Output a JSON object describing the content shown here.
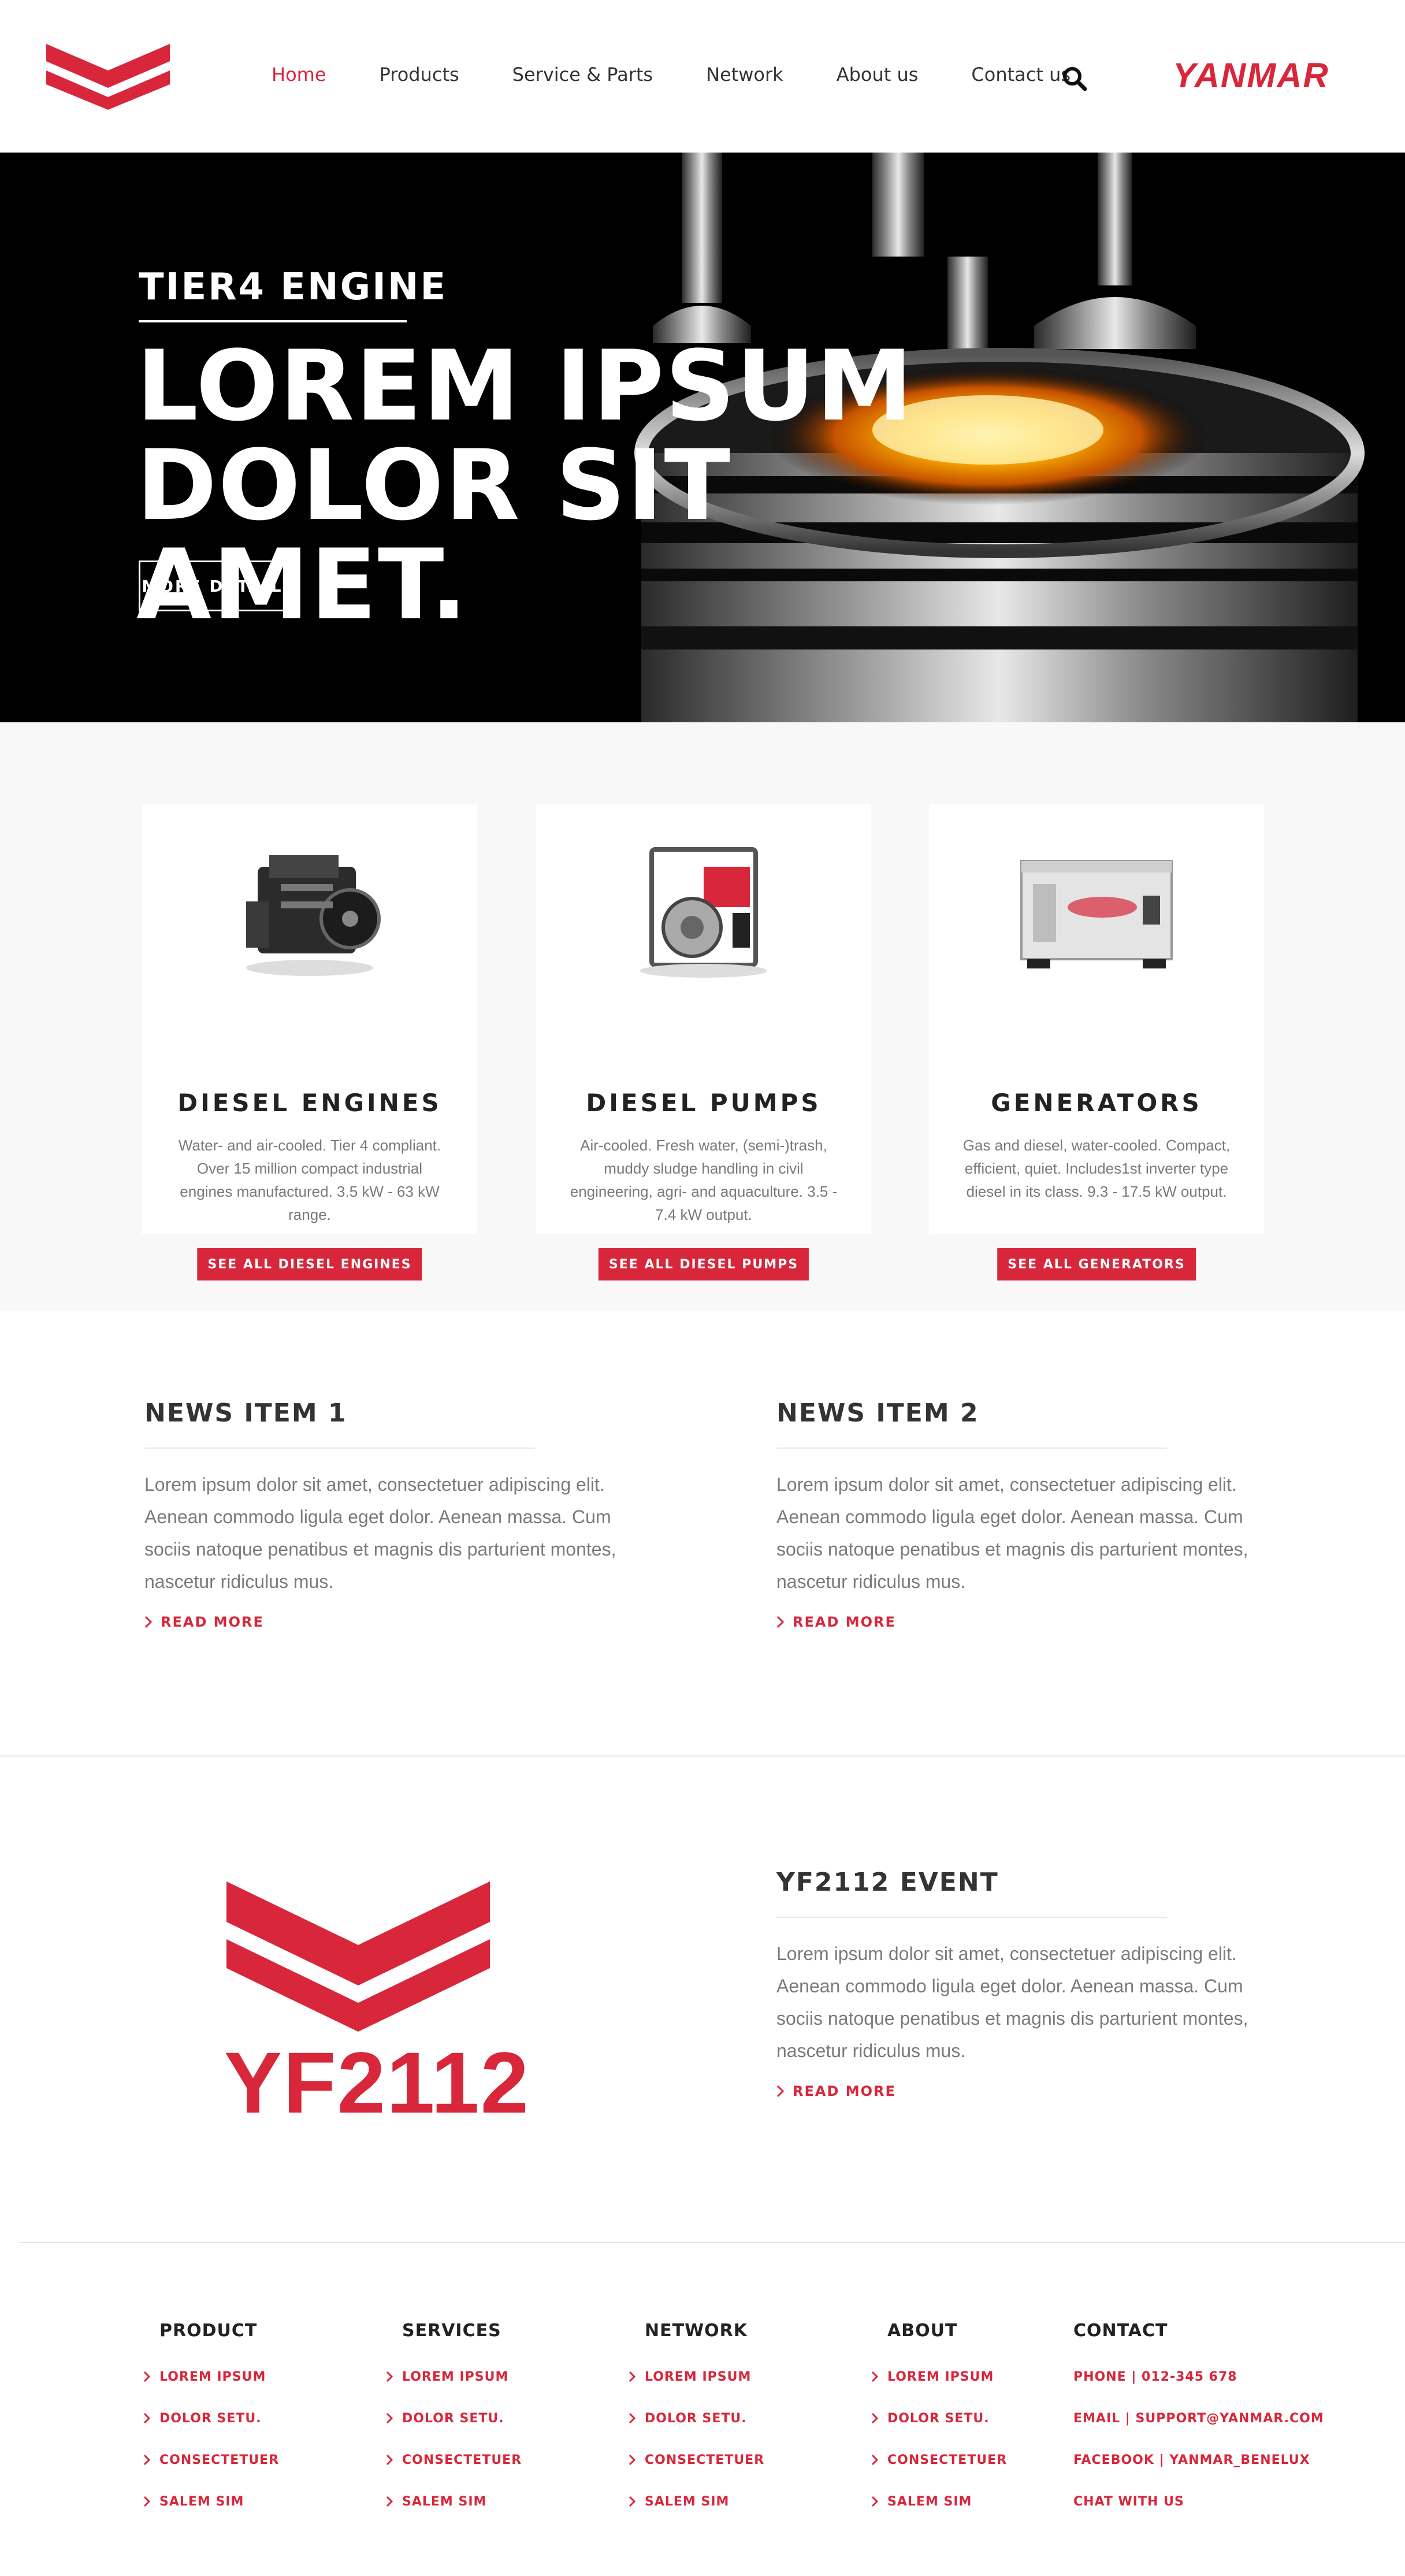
{
  "header": {
    "brand": "YANMAR",
    "nav": [
      "Home",
      "Products",
      "Service & Parts",
      "Network",
      "About us",
      "Contact us"
    ],
    "active_nav": "Home"
  },
  "hero": {
    "eyebrow": "TIER4 ENGINE",
    "title_line1": "LOREM IPSUM",
    "title_line2": "DOLOR SIT AMET.",
    "button": "MORE DETAILS"
  },
  "products": [
    {
      "title": "DIESEL ENGINES",
      "description": "Water- and air-cooled. Tier 4 compliant. Over 15 million compact industrial engines manufactured. 3.5 kW - 63 kW range.",
      "button": "SEE ALL DIESEL ENGINES"
    },
    {
      "title": "DIESEL PUMPS",
      "description": "Air-cooled. Fresh water, (semi-)trash, muddy sludge handling in civil engineering, agri- and aquaculture. 3.5 - 7.4 kW output.",
      "button": "SEE ALL DIESEL PUMPS"
    },
    {
      "title": "GENERATORS",
      "description": "Gas and diesel, water-cooled. Compact, efficient, quiet. Includes1st inverter type diesel in its class. 9.3 - 17.5 kW output.",
      "button": "SEE ALL GENERATORS"
    }
  ],
  "news": [
    {
      "title": "NEWS ITEM 1",
      "body": "Lorem ipsum dolor sit amet, consectetuer adipiscing elit. Aenean commodo ligula eget dolor. Aenean massa. Cum sociis natoque penatibus et magnis dis parturient montes, nascetur ridiculus mus.",
      "link": "READ MORE"
    },
    {
      "title": "NEWS ITEM 2",
      "body": "Lorem ipsum dolor sit amet, consectetuer adipiscing elit. Aenean commodo ligula eget dolor. Aenean massa. Cum sociis natoque penatibus et magnis dis parturient montes, nascetur ridiculus mus.",
      "link": "READ MORE"
    }
  ],
  "event": {
    "logo_text": "YF2112",
    "title": "YF2112 EVENT",
    "body": "Lorem ipsum dolor sit amet, consectetuer adipiscing elit. Aenean commodo ligula eget dolor. Aenean massa. Cum sociis natoque penatibus et magnis dis parturient montes, nascetur ridiculus mus.",
    "link": "READ MORE"
  },
  "footer": {
    "columns": [
      {
        "title": "PRODUCT",
        "links": [
          "LOREM IPSUM",
          "DOLOR SETU.",
          "CONSECTETUER",
          "SALEM SIM"
        ]
      },
      {
        "title": "SERVICES",
        "links": [
          "LOREM IPSUM",
          "DOLOR SETU.",
          "CONSECTETUER",
          "SALEM SIM"
        ]
      },
      {
        "title": "NETWORK",
        "links": [
          "LOREM IPSUM",
          "DOLOR SETU.",
          "CONSECTETUER",
          "SALEM SIM"
        ]
      },
      {
        "title": "ABOUT",
        "links": [
          "LOREM IPSUM",
          "DOLOR SETU.",
          "CONSECTETUER",
          "SALEM SIM"
        ]
      }
    ],
    "contact": {
      "title": "CONTACT",
      "lines": [
        "PHONE | 012-345 678",
        "EMAIL | SUPPORT@YANMAR.COM",
        "FACEBOOK | YANMAR_BENELUX",
        "CHAT WITH US"
      ]
    }
  },
  "colors": {
    "accent": "#d8263a",
    "text": "#333333",
    "muted": "#7a7a7a",
    "panel": "#f8f8f8"
  },
  "icons": [
    "yanmar-chevron-logo-icon",
    "search-icon",
    "chevron-right-icon"
  ]
}
